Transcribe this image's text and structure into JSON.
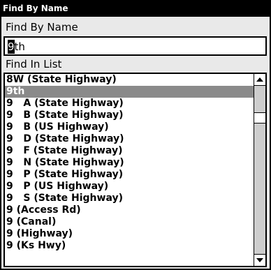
{
  "window": {
    "title": "Find By Name"
  },
  "search": {
    "label": "Find By Name",
    "cursor_char": "9",
    "rest_text": "th"
  },
  "list": {
    "label": "Find In List",
    "items": [
      "8W (State Highway)",
      "9th",
      "9   A (State Highway)",
      "9   B (State Highway)",
      "9   B (US Highway)",
      "9   D (State Highway)",
      "9   F (State Highway)",
      "9   N (State Highway)",
      "9   P (State Highway)",
      "9   P (US Highway)",
      "9   S (State Highway)",
      "9 (Access Rd)",
      "9 (Canal)",
      "9 (Highway)",
      "9 (Ks Hwy)"
    ],
    "selected_index": 1
  },
  "colors": {
    "background": "#000000",
    "panel": "#e9e9e9",
    "selection": "#8a8a8a"
  },
  "icons": {
    "scroll_up": "arrow-up-icon",
    "scroll_down": "arrow-down-icon"
  }
}
